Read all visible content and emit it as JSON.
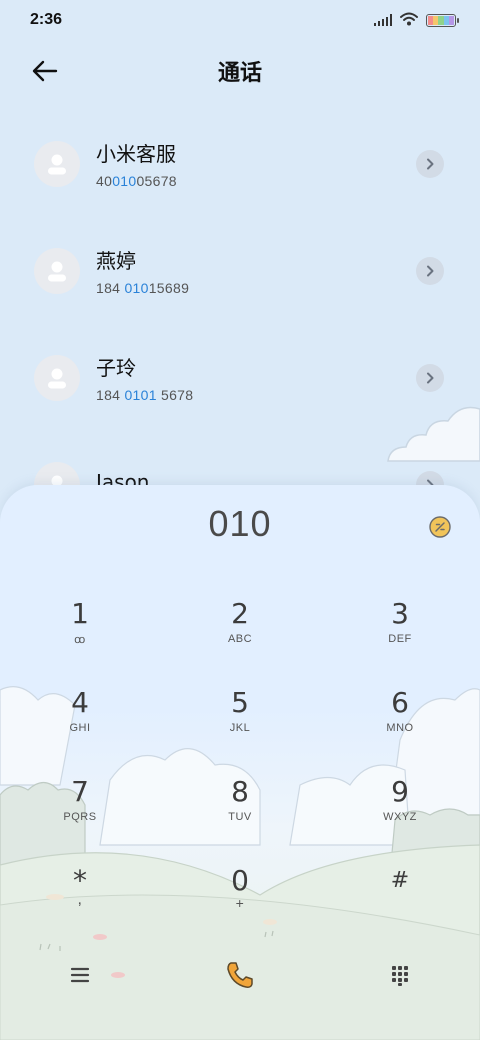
{
  "status_bar": {
    "time": "2:36",
    "icons": [
      "signal-icon",
      "wifi-icon",
      "battery-icon"
    ]
  },
  "header": {
    "title": "通话",
    "back_icon": "back-arrow-icon"
  },
  "contacts": [
    {
      "name": "小米客服",
      "number_parts": [
        "40",
        "010",
        "05678"
      ],
      "highlight_index": 1
    },
    {
      "name": "燕婷",
      "number_parts": [
        "184 ",
        "010",
        "15689"
      ],
      "highlight_index": 1
    },
    {
      "name": "子玲",
      "number_parts": [
        "184 ",
        "0101",
        " 5678"
      ],
      "highlight_index": 1
    },
    {
      "name": "Jason",
      "number_parts": [
        "",
        "",
        ""
      ],
      "highlight_index": 1
    }
  ],
  "dialpad": {
    "display_value": "010",
    "keys": [
      {
        "digit": "1",
        "letters": "ꝏ"
      },
      {
        "digit": "2",
        "letters": "ABC"
      },
      {
        "digit": "3",
        "letters": "DEF"
      },
      {
        "digit": "4",
        "letters": "GHI"
      },
      {
        "digit": "5",
        "letters": "JKL"
      },
      {
        "digit": "6",
        "letters": "MNO"
      },
      {
        "digit": "7",
        "letters": "PQRS"
      },
      {
        "digit": "8",
        "letters": "TUV"
      },
      {
        "digit": "9",
        "letters": "WXYZ"
      },
      {
        "digit": "*",
        "letters": ","
      },
      {
        "digit": "0",
        "letters": "+"
      },
      {
        "digit": "#",
        "letters": ""
      }
    ]
  },
  "bottom_bar": {
    "icons": [
      "menu-icon",
      "call-icon",
      "dialpad-icon"
    ]
  },
  "colors": {
    "background": "#dbeaf8",
    "highlight": "#2a82d8",
    "call_button": "#f0a53a",
    "chevron_bg": "#d2dbe6"
  }
}
